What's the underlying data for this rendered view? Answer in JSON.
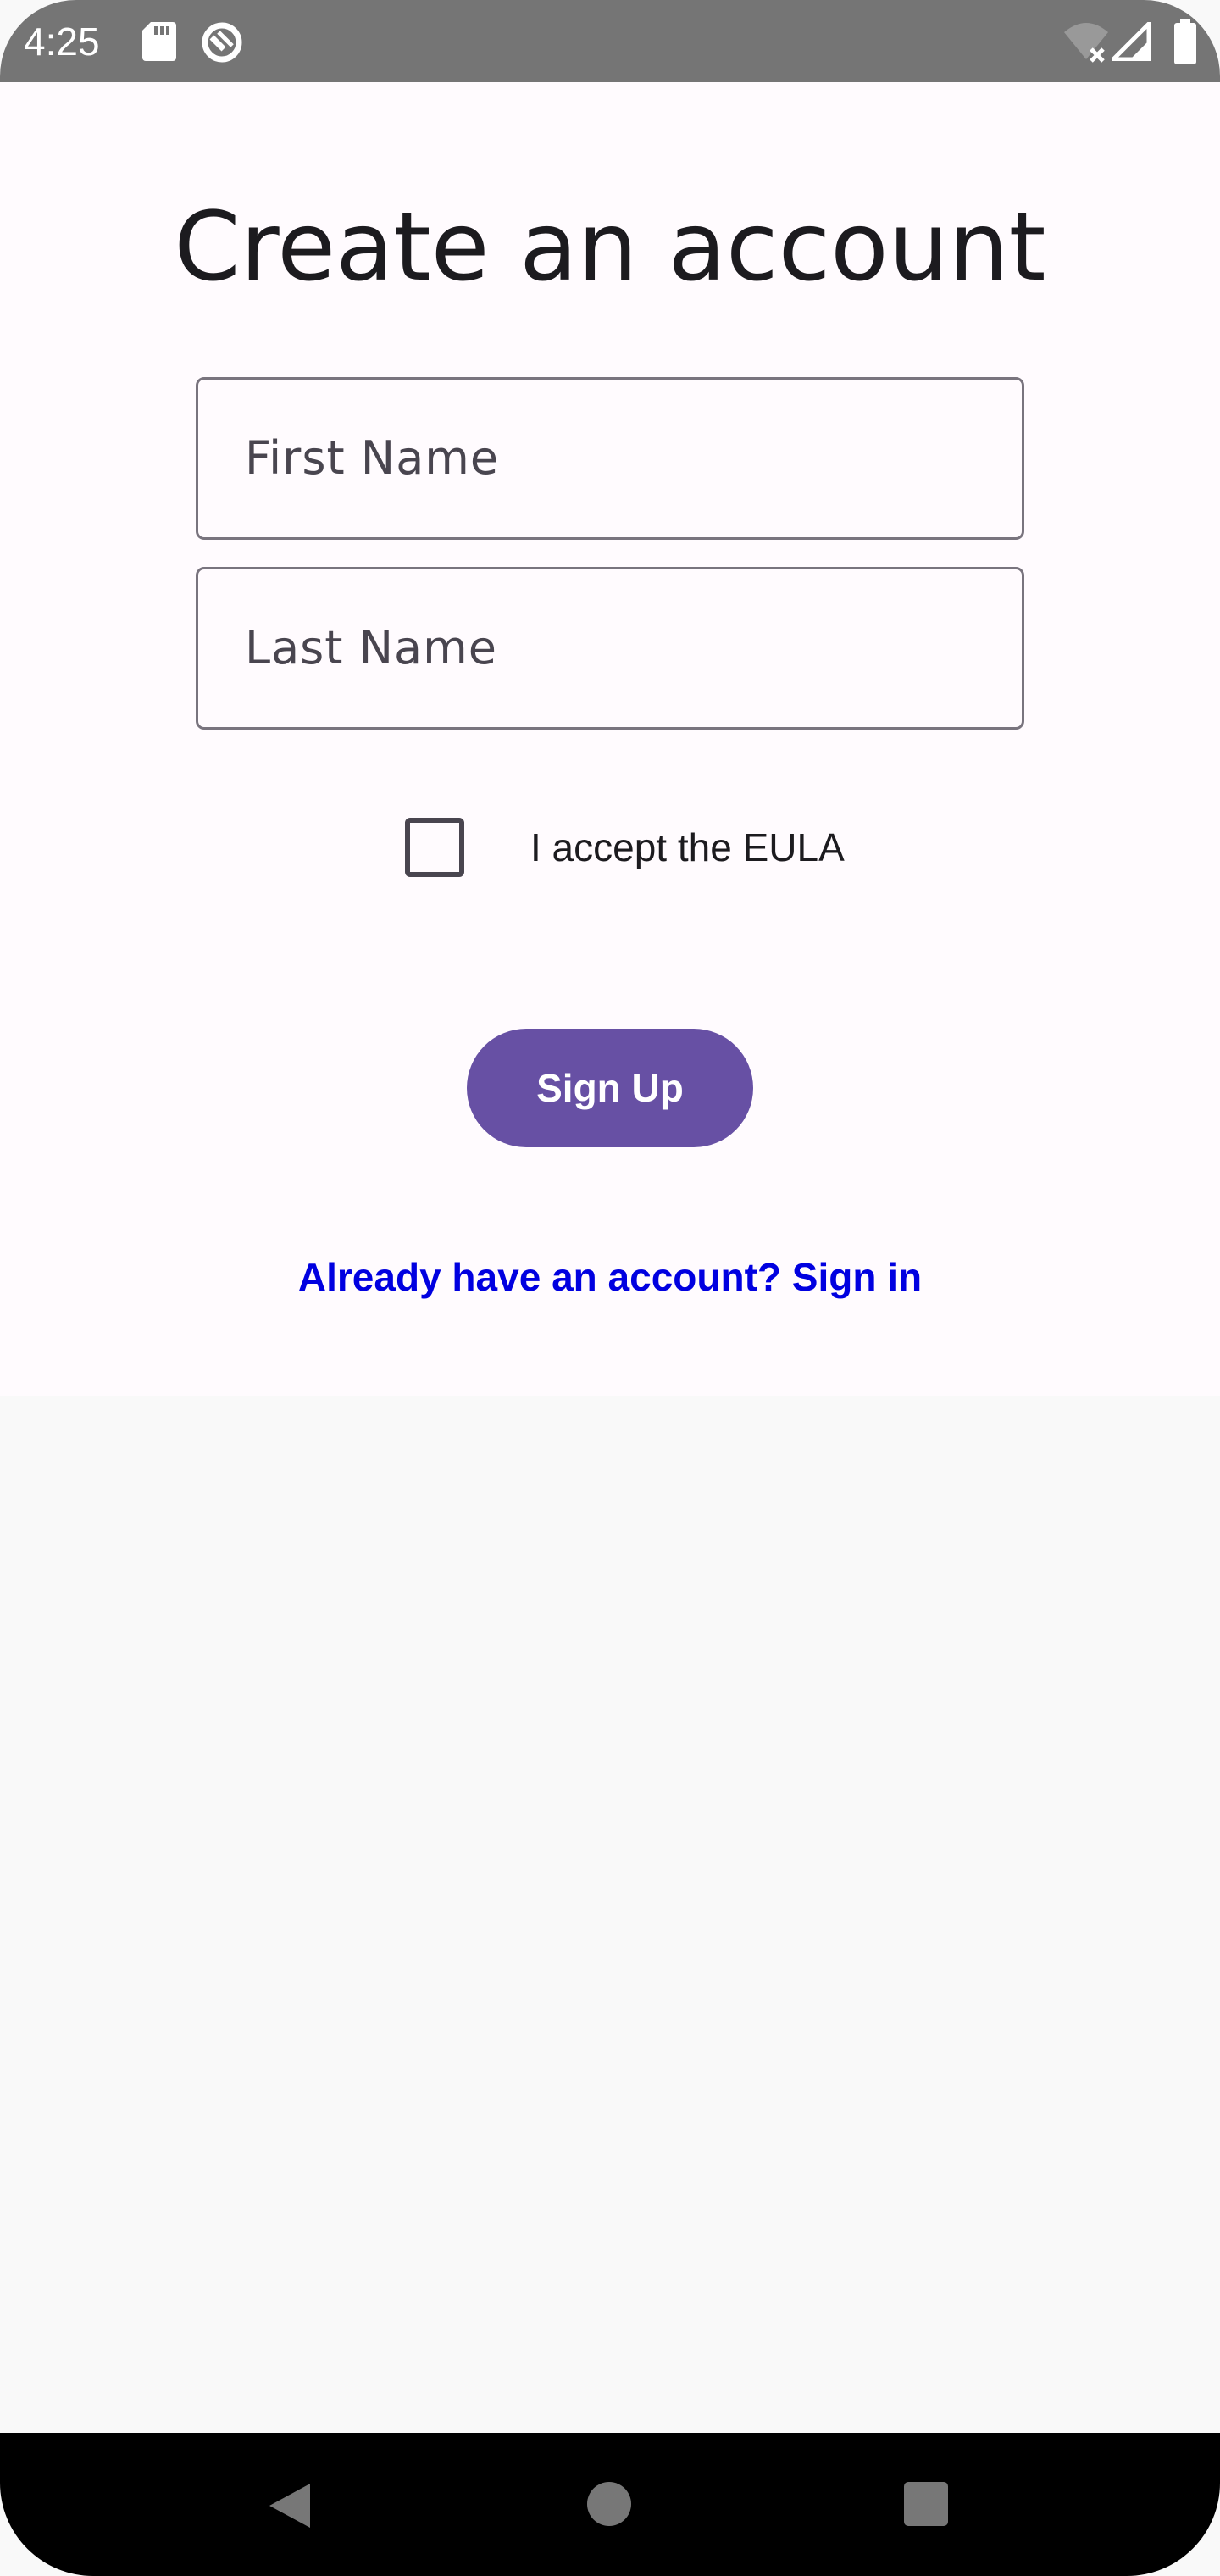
{
  "status_bar": {
    "time": "4:25",
    "icons": [
      "sd-card-icon",
      "sync-disabled-icon",
      "wifi-off-icon",
      "signal-icon",
      "battery-icon"
    ]
  },
  "form": {
    "title": "Create an account",
    "first_name_placeholder": "First Name",
    "last_name_placeholder": "Last Name",
    "first_name_value": "",
    "last_name_value": "",
    "eula_checked": false,
    "eula_label": "I accept the EULA",
    "signup_label": "Sign Up",
    "signin_link": "Already have an account? Sign in"
  },
  "nav_bar": {
    "icons": [
      "back-icon",
      "home-icon",
      "recents-icon"
    ]
  },
  "colors": {
    "primary": "#6750a4",
    "link": "#0000e0",
    "status_bar": "#757575",
    "background": "#fffbfe"
  }
}
